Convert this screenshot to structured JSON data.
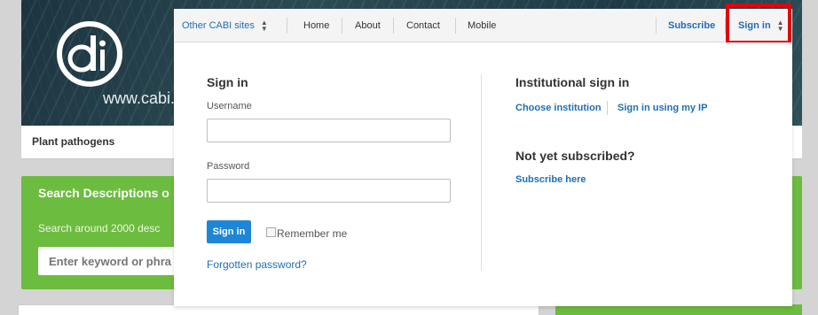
{
  "background": {
    "site_url": "www.cabi.or",
    "breadcrumb": "Plant pathogens",
    "search": {
      "title": "Search Descriptions o",
      "subtitle": "Search around 2000 desc",
      "input_placeholder": "Enter keyword or phra"
    }
  },
  "topbar": {
    "other_sites": "Other CABI sites",
    "nav": [
      "Home",
      "About",
      "Contact",
      "Mobile"
    ],
    "subscribe": "Subscribe",
    "signin": "Sign in"
  },
  "signin_panel": {
    "heading": "Sign in",
    "username_label": "Username",
    "password_label": "Password",
    "signin_button": "Sign in",
    "remember_me": "Remember me",
    "forgot_password": "Forgotten password?"
  },
  "institutional": {
    "heading": "Institutional sign in",
    "choose_institution": "Choose institution",
    "sign_in_ip": "Sign in using my IP"
  },
  "not_subscribed": {
    "heading": "Not yet subscribed?",
    "subscribe_here": "Subscribe here"
  },
  "colors": {
    "brand_green": "#6cbc3f",
    "link_blue": "#1f6fb2",
    "button_blue": "#1d86d6",
    "highlight_red": "#e4000f"
  },
  "icons": [
    "cabi-logo",
    "updown-arrows-icon"
  ]
}
